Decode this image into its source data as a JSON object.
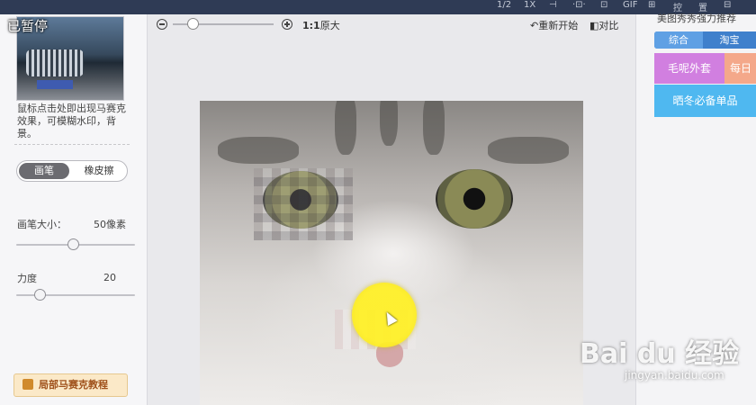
{
  "topbar": {
    "items": [
      "1/2",
      "1X",
      "⊣",
      "·⊡·",
      "⊡",
      "⊠",
      "GIF",
      "⊞",
      "控",
      "置",
      "⊟",
      "⊡"
    ]
  },
  "left": {
    "status": "已暂停",
    "hint": "鼠标点击处即出现马赛克效果，可模糊水印，背景。",
    "tool_active": "画笔",
    "tool_inactive": "橡皮擦",
    "brush_size_label": "画笔大小：",
    "brush_size_value": "50像素",
    "brush_size_level": 0.48,
    "strength_label": "力度",
    "strength_value": "20",
    "strength_level": 0.2,
    "tutorial": "局部马赛克教程"
  },
  "center": {
    "ratio_bold": "1:1",
    "ratio_text": "原大",
    "zoom_level": 0.2,
    "reset": "重新开始",
    "compare": "对比"
  },
  "right": {
    "title": "美图秀秀强力推荐",
    "tabs": [
      "综合",
      "淘宝"
    ],
    "tile1": "毛呢外套",
    "tile2": "每日",
    "tile3": "晒冬必备单品"
  },
  "watermark": {
    "brand": "Bai du 经验",
    "url": "jingyan.baidu.com"
  },
  "colors": {
    "accent": "#4a90d9",
    "brush": "#f5e61c",
    "topbar": "#2f3b55"
  }
}
